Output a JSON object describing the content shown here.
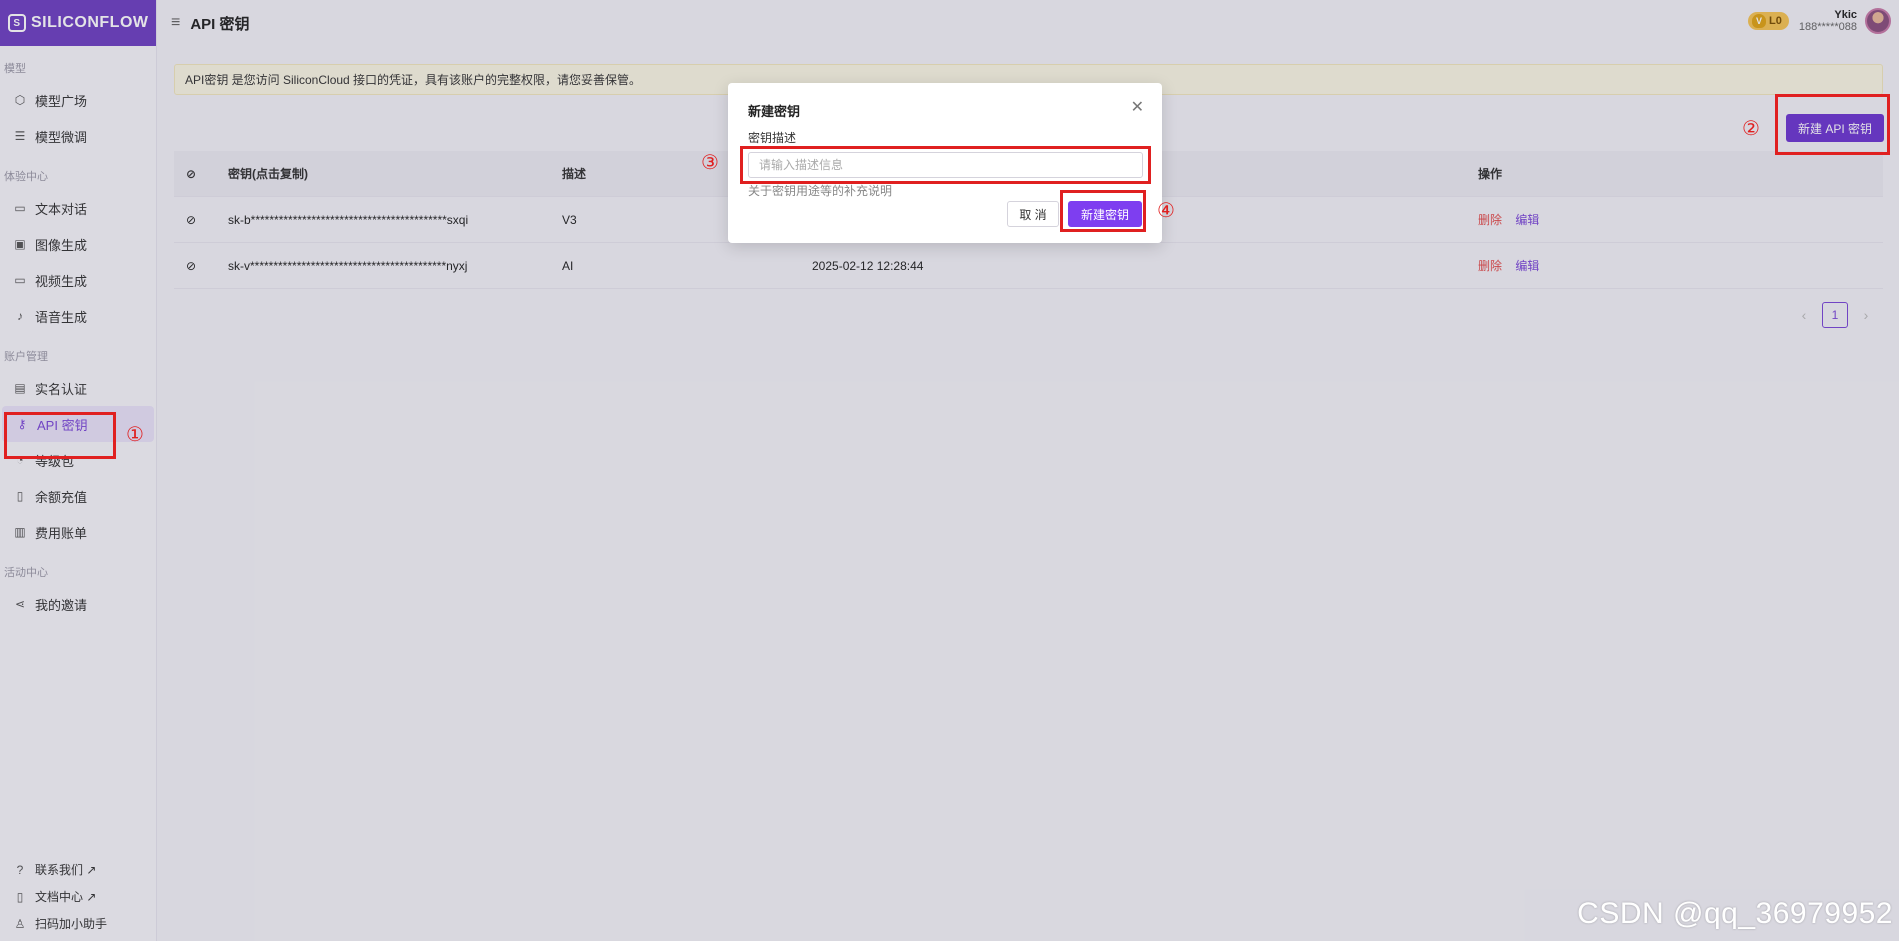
{
  "app": {
    "logo_text": "SILICONFLOW",
    "page_title": "API 密钥"
  },
  "sidebar": {
    "sections": [
      {
        "label": "模型",
        "items": [
          {
            "label": "模型广场",
            "icon": "cube-icon"
          },
          {
            "label": "模型微调",
            "icon": "sliders-icon"
          }
        ]
      },
      {
        "label": "体验中心",
        "items": [
          {
            "label": "文本对话",
            "icon": "chat-icon"
          },
          {
            "label": "图像生成",
            "icon": "image-icon"
          },
          {
            "label": "视频生成",
            "icon": "video-icon"
          },
          {
            "label": "语音生成",
            "icon": "mic-icon"
          }
        ]
      },
      {
        "label": "账户管理",
        "items": [
          {
            "label": "实名认证",
            "icon": "id-card-icon"
          },
          {
            "label": "API 密钥",
            "icon": "key-icon",
            "active": true
          },
          {
            "label": "等级包",
            "icon": "gauge-icon"
          },
          {
            "label": "余额充值",
            "icon": "wallet-icon"
          },
          {
            "label": "费用账单",
            "icon": "bill-icon"
          }
        ]
      },
      {
        "label": "活动中心",
        "items": [
          {
            "label": "我的邀请",
            "icon": "share-icon"
          }
        ]
      }
    ],
    "bottom": [
      {
        "label": "联系我们 ↗",
        "icon": "help-icon"
      },
      {
        "label": "文档中心 ↗",
        "icon": "doc-icon"
      },
      {
        "label": "扫码加小助手",
        "icon": "user-icon"
      }
    ]
  },
  "user": {
    "level": "L0",
    "name": "Ykic",
    "phone": "188*****088"
  },
  "notice": "API密钥 是您访问 SiliconCloud 接口的凭证，具有该账户的完整权限，请您妥善保管。",
  "new_key_button": "新建 API 密钥",
  "table": {
    "headers": {
      "key": "密钥(点击复制)",
      "desc": "描述",
      "ops": "操作"
    },
    "rows": [
      {
        "key": "sk-b******************************************sxqi",
        "desc": "V3",
        "time": "",
        "delete": "删除",
        "edit": "编辑"
      },
      {
        "key": "sk-v******************************************nyxj",
        "desc": "AI",
        "time": "2025-02-12 12:28:44",
        "delete": "删除",
        "edit": "编辑"
      }
    ]
  },
  "pagination": {
    "current": "1"
  },
  "modal": {
    "title": "新建密钥",
    "field_label": "密钥描述",
    "placeholder": "请输入描述信息",
    "hint": "关于密钥用途等的补充说明",
    "cancel": "取 消",
    "confirm": "新建密钥"
  },
  "annotations": [
    "①",
    "②",
    "③",
    "④"
  ],
  "watermark": "CSDN @qq_36979952",
  "colors": {
    "brand": "#6d36d1",
    "accent": "#7e3ef0",
    "danger": "#e24b4b",
    "annotation": "#e02020"
  }
}
